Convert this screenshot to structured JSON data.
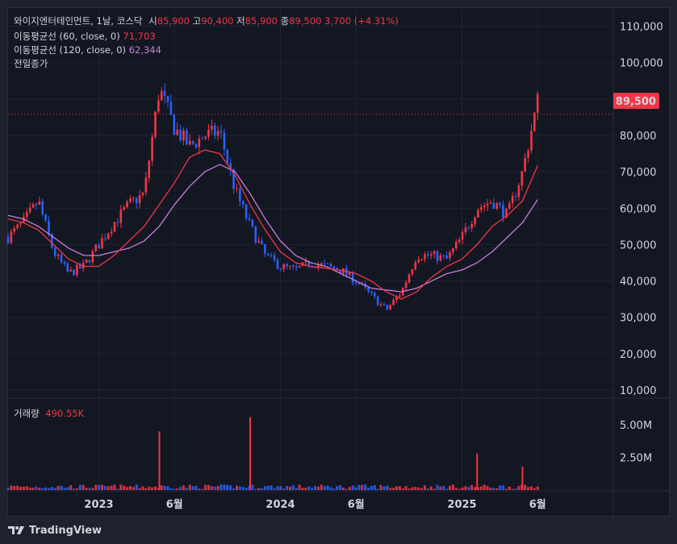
{
  "header": {
    "symbol": "와이지엔터테인먼트, 1날, 코스닥",
    "open_label": "시",
    "open": "85,900",
    "high_label": "고",
    "high": "90,400",
    "low_label": "저",
    "low": "85,900",
    "close_label": "종",
    "close": "89,500",
    "change": "3,700 (+4.31%)"
  },
  "indicators": {
    "ma60_label": "이동평균선 (60, close, 0)",
    "ma60_value": "71,703",
    "ma120_label": "이동평균선 (120, close, 0)",
    "ma120_value": "62,344",
    "prev_close_label": "전일종가"
  },
  "volume": {
    "label": "거래량",
    "value": "490.55K"
  },
  "last_price_tag": "89,500",
  "brand": {
    "name": "TradingView"
  },
  "colors": {
    "up": "#f23645",
    "down": "#2962ff",
    "ma60": "#f23645",
    "ma120": "#c77ddb",
    "bg": "#131722"
  },
  "chart_data": {
    "type": "candlestick",
    "price_axis": {
      "ticks": [
        "110,000",
        "100,000",
        "90,000",
        "80,000",
        "70,000",
        "60,000",
        "50,000",
        "40,000",
        "30,000",
        "20,000",
        "10,000"
      ],
      "tick_values": [
        110000,
        100000,
        90000,
        80000,
        70000,
        60000,
        50000,
        40000,
        30000,
        20000,
        10000
      ],
      "range": [
        8000,
        115000
      ]
    },
    "volume_axis": {
      "ticks": [
        "5.00M",
        "2.50M"
      ],
      "tick_values": [
        5000000,
        2500000
      ],
      "range": [
        0,
        6500000
      ]
    },
    "time_axis": {
      "ticks": [
        "2023",
        "6월",
        "2024",
        "6월",
        "2025",
        "6월"
      ],
      "tick_dates": [
        "2023-01",
        "2023-06",
        "2024-01",
        "2024-06",
        "2025-01",
        "2025-06"
      ]
    },
    "time_range": [
      "2022-07",
      "2025-11"
    ],
    "price_series": {
      "name": "close",
      "dates": [
        "2022-07",
        "2022-08",
        "2022-09",
        "2022-10",
        "2022-11",
        "2022-12",
        "2023-01",
        "2023-02",
        "2023-03",
        "2023-04",
        "2023-05",
        "2023-06",
        "2023-07",
        "2023-08",
        "2023-09",
        "2023-10",
        "2023-11",
        "2023-12",
        "2024-01",
        "2024-02",
        "2024-03",
        "2024-04",
        "2024-05",
        "2024-06",
        "2024-07",
        "2024-08",
        "2024-09",
        "2024-10",
        "2024-11",
        "2024-12",
        "2025-01",
        "2025-02",
        "2025-03",
        "2025-04",
        "2025-05",
        "2025-06"
      ],
      "values": [
        52000,
        56000,
        62000,
        48000,
        42000,
        44000,
        50000,
        56000,
        61000,
        64000,
        93000,
        82000,
        77000,
        80000,
        81000,
        65000,
        55000,
        47000,
        44000,
        43000,
        45000,
        44000,
        43000,
        40000,
        36000,
        32000,
        37000,
        47000,
        47000,
        46000,
        52000,
        60000,
        62000,
        58000,
        70000,
        89500
      ]
    },
    "ma60": {
      "name": "이동평균선 (60, close, 0)",
      "values": [
        57000,
        56000,
        54000,
        50000,
        46000,
        44000,
        44000,
        47000,
        51000,
        55000,
        61000,
        67000,
        74000,
        76000,
        75000,
        69000,
        61000,
        54000,
        48000,
        45000,
        44000,
        43500,
        43000,
        42000,
        40000,
        37000,
        35000,
        37000,
        41000,
        44000,
        46000,
        50000,
        55000,
        58000,
        62000,
        71703
      ]
    },
    "ma120": {
      "name": "이동평균선 (120, close, 0)",
      "values": [
        58000,
        57000,
        55000,
        52000,
        49000,
        47000,
        47000,
        48000,
        49000,
        51000,
        55000,
        61000,
        66000,
        70000,
        72000,
        70000,
        64000,
        57000,
        51000,
        47000,
        45000,
        44000,
        42000,
        40000,
        38000,
        37500,
        37000,
        38000,
        40000,
        42000,
        43000,
        45000,
        48000,
        52000,
        56000,
        62344
      ]
    },
    "volume_spikes": [
      {
        "date": "2023-05",
        "value": 4500000
      },
      {
        "date": "2023-11",
        "value": 5600000
      },
      {
        "date": "2025-02",
        "value": 2800000
      },
      {
        "date": "2025-05",
        "value": 1800000
      }
    ],
    "prev_close": 85800
  }
}
